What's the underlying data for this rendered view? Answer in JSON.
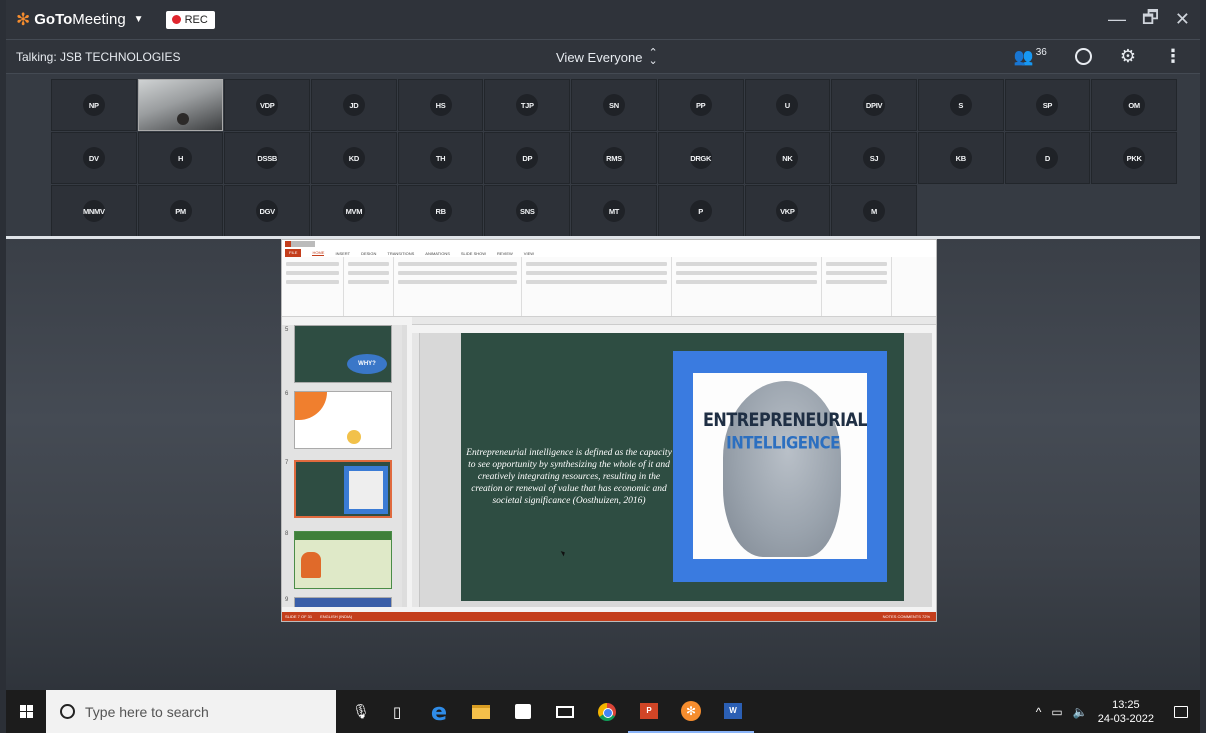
{
  "app": {
    "brand_goto": "GoTo",
    "brand_meeting": "Meeting",
    "rec_label": "REC",
    "window_controls": [
      "—",
      "🗗",
      "✕"
    ]
  },
  "infobar": {
    "talking": "Talking: JSB TECHNOLOGIES",
    "view_selector": "View Everyone",
    "participant_count": "36"
  },
  "participants": [
    {
      "initials": "NP"
    },
    {
      "initials": "",
      "video": true
    },
    {
      "initials": "VDP"
    },
    {
      "initials": "JD"
    },
    {
      "initials": "HS"
    },
    {
      "initials": "TJP"
    },
    {
      "initials": "SN"
    },
    {
      "initials": "PP"
    },
    {
      "initials": "U"
    },
    {
      "initials": "DPIV"
    },
    {
      "initials": "S"
    },
    {
      "initials": "SP"
    },
    {
      "initials": "OM"
    },
    {
      "initials": "DV"
    },
    {
      "initials": "H"
    },
    {
      "initials": "DSSB"
    },
    {
      "initials": "KD"
    },
    {
      "initials": "TH"
    },
    {
      "initials": "DP"
    },
    {
      "initials": "RMS"
    },
    {
      "initials": "DRGK"
    },
    {
      "initials": "NK"
    },
    {
      "initials": "SJ"
    },
    {
      "initials": "KB"
    },
    {
      "initials": "D"
    },
    {
      "initials": "PKK"
    },
    {
      "initials": "MNMV"
    },
    {
      "initials": "PM"
    },
    {
      "initials": "DGV"
    },
    {
      "initials": "MVM"
    },
    {
      "initials": "RB"
    },
    {
      "initials": "SNS"
    },
    {
      "initials": "MT"
    },
    {
      "initials": "P"
    },
    {
      "initials": "VKP"
    },
    {
      "initials": "M"
    }
  ],
  "presentation": {
    "tabs": [
      "FILE",
      "HOME",
      "INSERT",
      "DESIGN",
      "TRANSITIONS",
      "ANIMATIONS",
      "SLIDE SHOW",
      "REVIEW",
      "VIEW"
    ],
    "thumb_numbers": [
      "5",
      "6",
      "7",
      "8",
      "9"
    ],
    "thumb5_button": "WHY?",
    "slide_text": "Entrepreneurial intelligence is defined as the capacity to see opportunity by synthesizing the whole of it and creatively integrating resources, resulting in the creation or renewal of value that has economic and societal significance (Oosthuizen, 2016)",
    "image_line1": "ENTREPRENEURIAL",
    "image_line2": "INTELLIGENCE",
    "status_left": "SLIDE 7 OF 31",
    "status_lang": "ENGLISH (INDIA)",
    "status_right": "NOTES   COMMENTS   72%"
  },
  "taskbar": {
    "search_placeholder": "Type here to search",
    "time": "13:25",
    "date": "24-03-2022",
    "ppt_label": "P",
    "word_label": "W"
  }
}
